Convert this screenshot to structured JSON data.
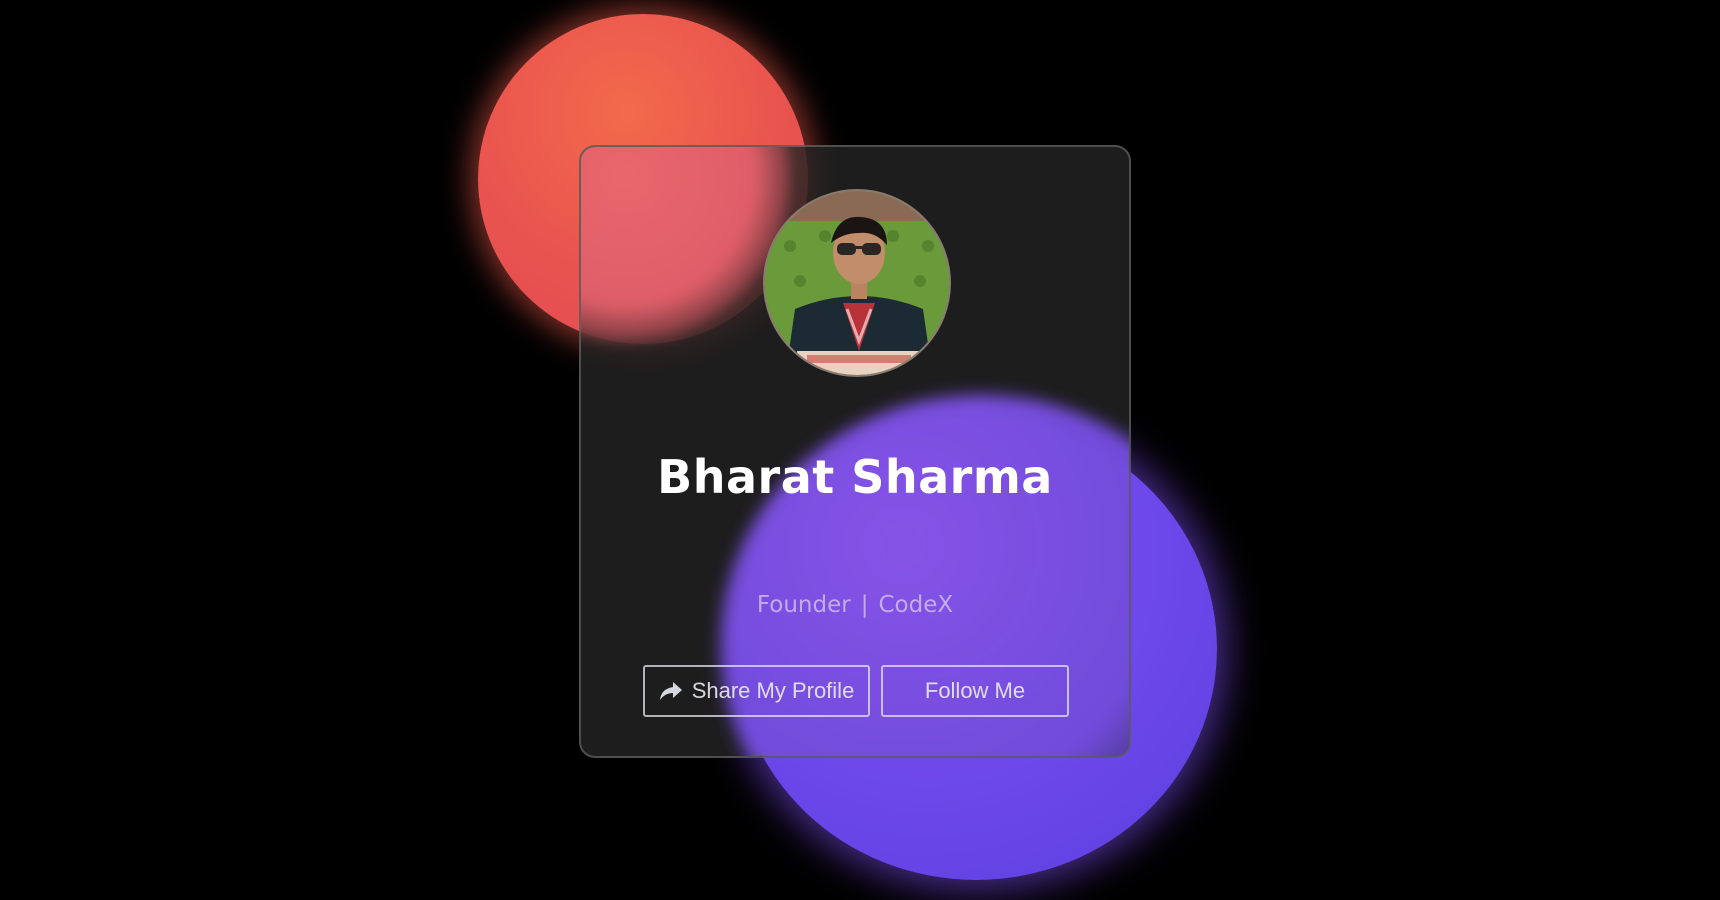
{
  "profile": {
    "name": "Bharat Sharma",
    "role_title": "Founder",
    "separator": "|",
    "company": "CodeX",
    "avatar_alt": "profile photo"
  },
  "actions": {
    "share_label": "Share My Profile",
    "share_icon": "share-arrow-icon",
    "follow_label": "Follow Me"
  },
  "colors": {
    "background": "#000000",
    "accent_red": "#e9534f",
    "accent_purple": "#6e48ea",
    "card": "#232323"
  }
}
